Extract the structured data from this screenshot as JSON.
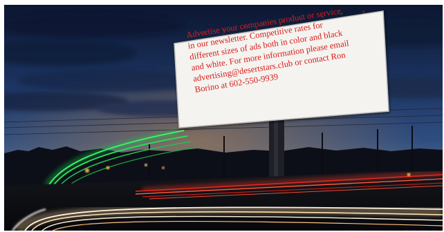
{
  "billboard": {
    "lines": [
      "Advertise your companies product or service",
      "in our newsletter.  Competitive rates for",
      "different sizes of ads both in color and black",
      "and white.  For more information please email",
      "advertising@desertstars.club or contact Ron",
      "Borino at 602-550-9939"
    ]
  },
  "colors": {
    "text": "#d81b1b",
    "sky_top": "#0d1a3a",
    "sky_bottom": "#2b4777",
    "horizon_glow": "#c5833f",
    "light_trail_green": "#2bdc5a",
    "light_trail_red": "#e02a1e",
    "light_trail_white": "#fff4e0"
  }
}
